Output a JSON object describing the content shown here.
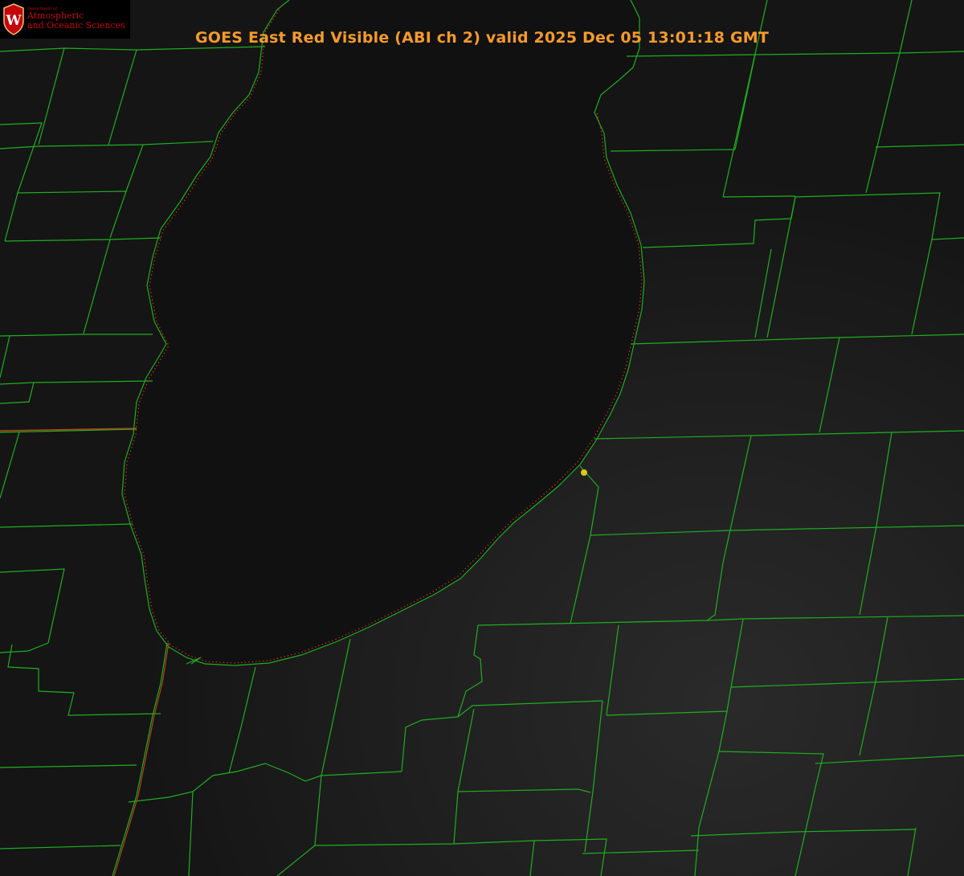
{
  "title": "GOES East Red Visible (ABI ch 2) valid 2025 Dec 05 13:01:18 GMT",
  "logo": {
    "crest_letter": "W",
    "department_small": "Department of",
    "line1": "Atmospheric",
    "line2": "and Oceanic Sciences"
  },
  "colors": {
    "background": "#0d0d0d",
    "lake": "#121212",
    "county_lines": "#1fae1f",
    "state_lines": "#b5451b",
    "coast_dots": "#d2302a",
    "station_marker": "#d9c81a",
    "title_text": "#f59a2a",
    "logo_red": "#c5050c"
  },
  "icons": {
    "crest": "uw-crest-icon",
    "station": "station-marker-icon"
  }
}
